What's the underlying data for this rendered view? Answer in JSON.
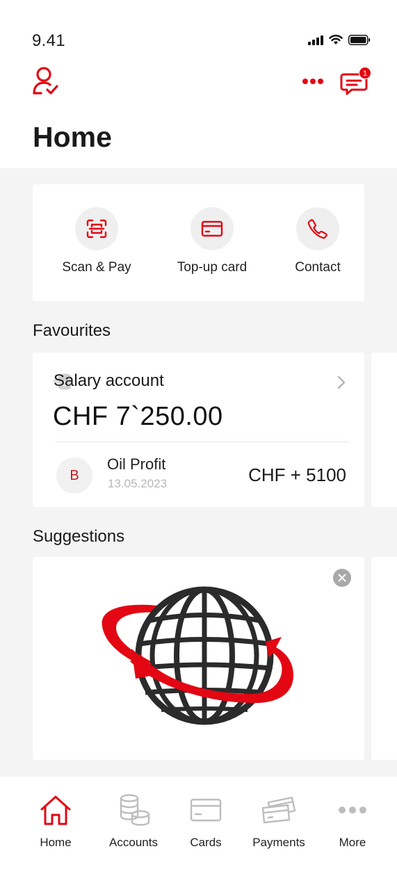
{
  "status_bar": {
    "time": "9.41"
  },
  "header": {
    "title": "Home",
    "notification_count": "1"
  },
  "quick_actions": [
    {
      "label": "Scan & Pay",
      "icon": "scan-icon"
    },
    {
      "label": "Top-up card",
      "icon": "card-icon"
    },
    {
      "label": "Contact",
      "icon": "phone-icon"
    }
  ],
  "favourites": {
    "title": "Favourites",
    "account": {
      "name": "Salary account",
      "balance": "CHF 7`250.00",
      "icon": "coins-icon"
    },
    "transaction": {
      "avatar_letter": "B",
      "name": "Oil Profit",
      "date": "13.05.2023",
      "amount": "CHF + 5100"
    }
  },
  "suggestions": {
    "title": "Suggestions",
    "image": "globe-arrows-illustration"
  },
  "tabbar": {
    "tabs": [
      {
        "label": "Home",
        "icon": "home-icon",
        "active": true
      },
      {
        "label": "Accounts",
        "icon": "coins-icon"
      },
      {
        "label": "Cards",
        "icon": "card-icon"
      },
      {
        "label": "Payments",
        "icon": "payments-icon"
      },
      {
        "label": "More",
        "icon": "more-dots-icon"
      }
    ]
  },
  "colors": {
    "accent": "#e30613",
    "background": "#f4f4f4",
    "card": "#ffffff"
  }
}
